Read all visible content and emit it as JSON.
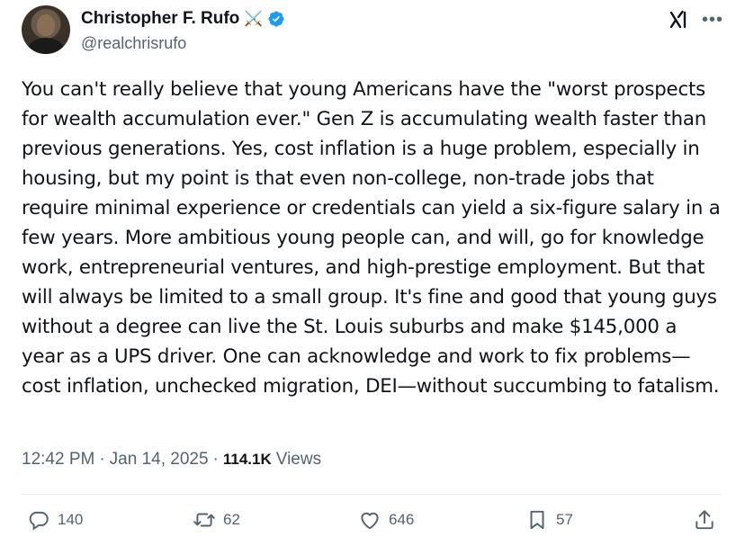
{
  "author": {
    "display_name": "Christopher F. Rufo",
    "emoji": "⚔️",
    "handle": "@realchrisrufo"
  },
  "tweet": {
    "text": "You can't really believe that young Americans have the \"worst prospects for wealth accumulation ever.\" Gen Z is accumulating wealth faster than previous generations. Yes, cost inflation is a huge problem, especially in housing, but my point is that even non-college, non-trade jobs that require minimal experience or credentials can yield a six-figure salary in a few years. More ambitious young people can, and will, go for knowledge work, entrepreneurial ventures, and high-prestige employment. But that will always be limited to a small group. It's fine and good that young guys without a degree can live the St. Louis suburbs and make $145,000 a year as a UPS driver. One can acknowledge and work to fix problems—cost inflation, unchecked migration, DEI—without succumbing to fatalism.",
    "time": "12:42 PM",
    "separator": "·",
    "date": "Jan 14, 2025",
    "views_count": "114.1K",
    "views_label": "Views"
  },
  "stats": {
    "replies": "140",
    "reposts": "62",
    "likes": "646",
    "bookmarks": "57"
  },
  "icons": {
    "more": "more-icon",
    "grok": "grok-icon",
    "verified": "verified-badge-icon"
  },
  "colors": {
    "verified_blue": "#1d9bf0",
    "secondary_text": "#536471"
  }
}
